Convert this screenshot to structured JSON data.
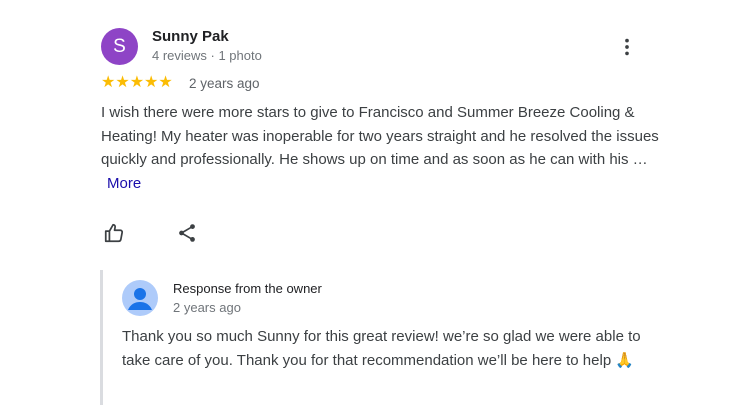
{
  "review": {
    "avatar_letter": "S",
    "avatar_color": "#8e44c6",
    "author": "Sunny Pak",
    "author_meta": "4 reviews · 1 photo",
    "rating": 5,
    "stars_text": "★★★★★",
    "star_color": "#fbbc04",
    "date": "2 years ago",
    "text": "I wish there were more stars to give to Francisco and Summer Breeze Cooling & Heating! My heater was inoperable for two years straight and he resolved the issues quickly and professionally. He shows up on time and as soon as he can with his …",
    "more_label": "More",
    "icons": {
      "menu": "more-vert-icon",
      "like": "thumbs-up-icon",
      "share": "share-icon"
    }
  },
  "owner_response": {
    "title": "Response from the owner",
    "date": "2 years ago",
    "text": "Thank you so much Sunny for this great review! we’re so glad we were able to take care of you. Thank you for that recommendation we’ll be here to help 🙏",
    "avatar_icon": "person-avatar-icon",
    "avatar_color": "#aecbfa"
  }
}
